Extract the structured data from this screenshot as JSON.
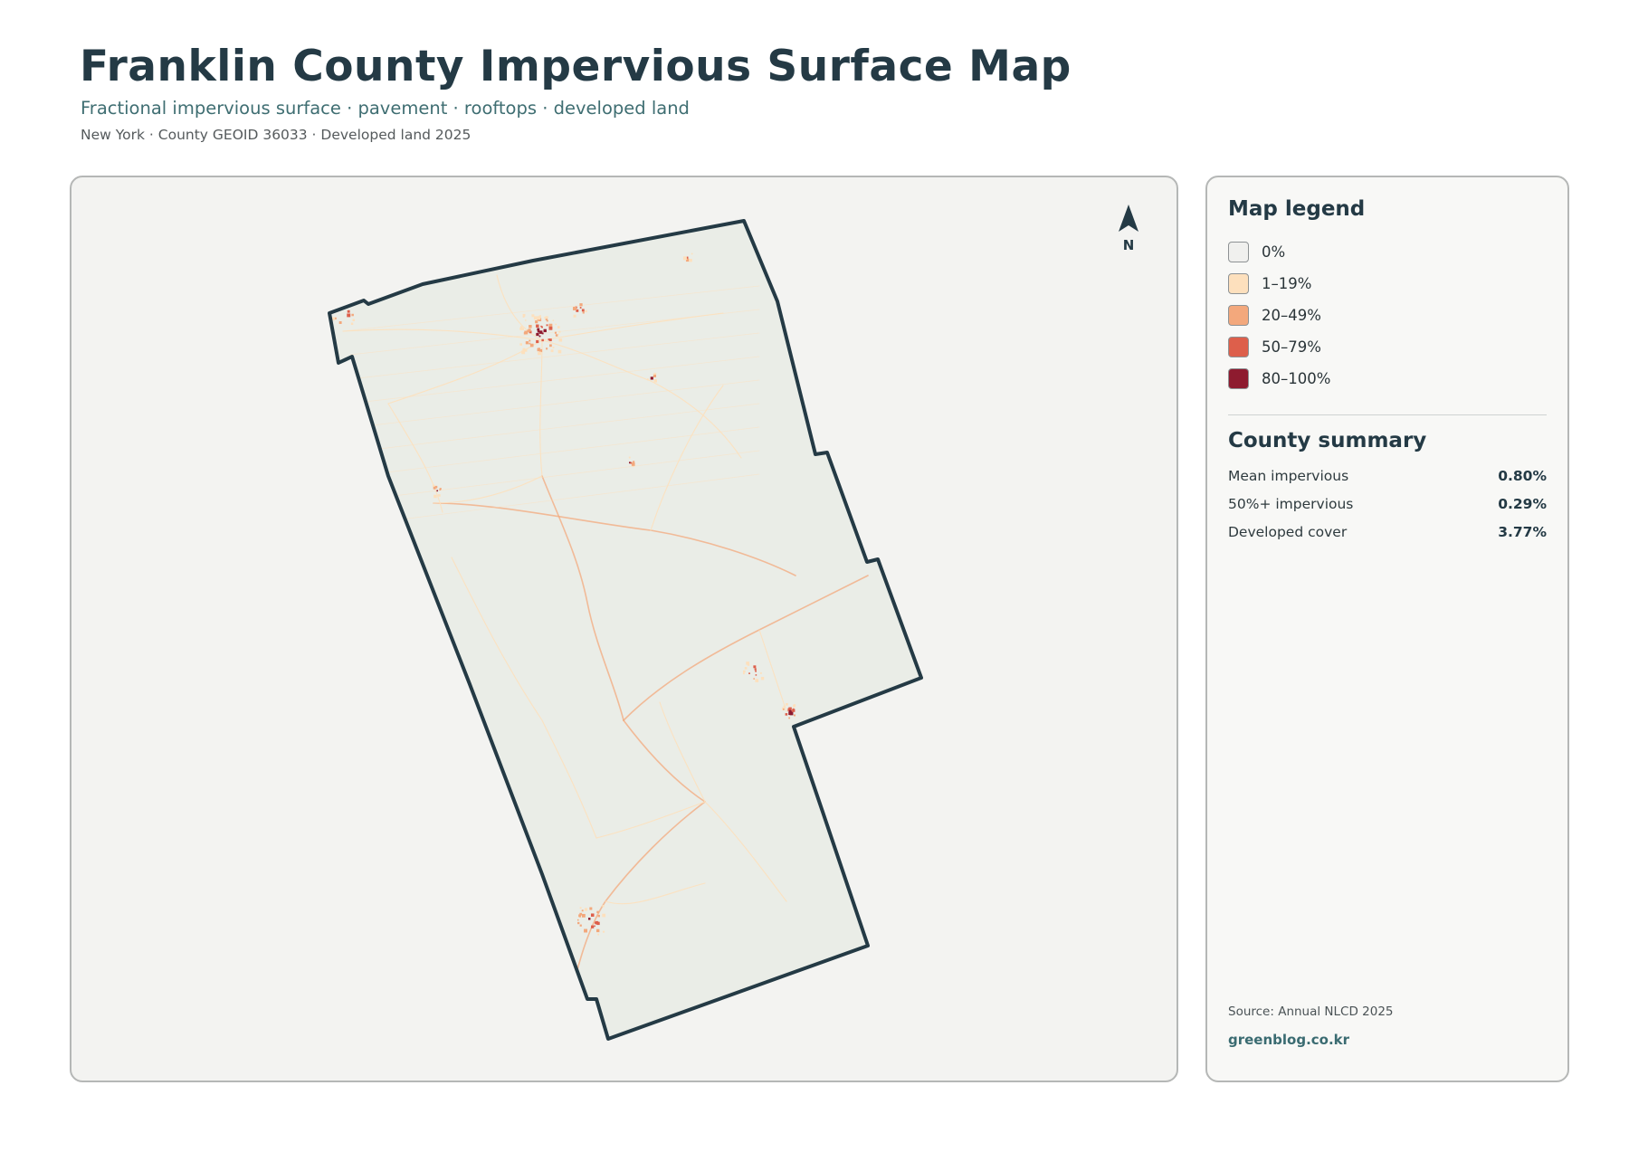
{
  "header": {
    "title": "Franklin County Impervious Surface Map",
    "subtitle": "Fractional impervious surface · pavement · rooftops · developed land",
    "meta": "New York · County GEOID 36033 · Developed land 2025"
  },
  "map": {
    "north_label": "N",
    "county_fill": "#eaede7",
    "boundary_color": "#243a45"
  },
  "legend": {
    "heading": "Map legend",
    "items": [
      {
        "label": "0%",
        "color": "#f0f0ee"
      },
      {
        "label": "1–19%",
        "color": "#fde0bd"
      },
      {
        "label": "20–49%",
        "color": "#f3a87c"
      },
      {
        "label": "50–79%",
        "color": "#dd5f4b"
      },
      {
        "label": "80–100%",
        "color": "#8e1b2f"
      }
    ]
  },
  "summary": {
    "heading": "County summary",
    "rows": [
      {
        "label": "Mean impervious",
        "value": "0.80%"
      },
      {
        "label": "50%+ impervious",
        "value": "0.29%"
      },
      {
        "label": "Developed cover",
        "value": "3.77%"
      }
    ]
  },
  "footer": {
    "source": "Source: Annual NLCD 2025",
    "website": "greenblog.co.kr"
  }
}
